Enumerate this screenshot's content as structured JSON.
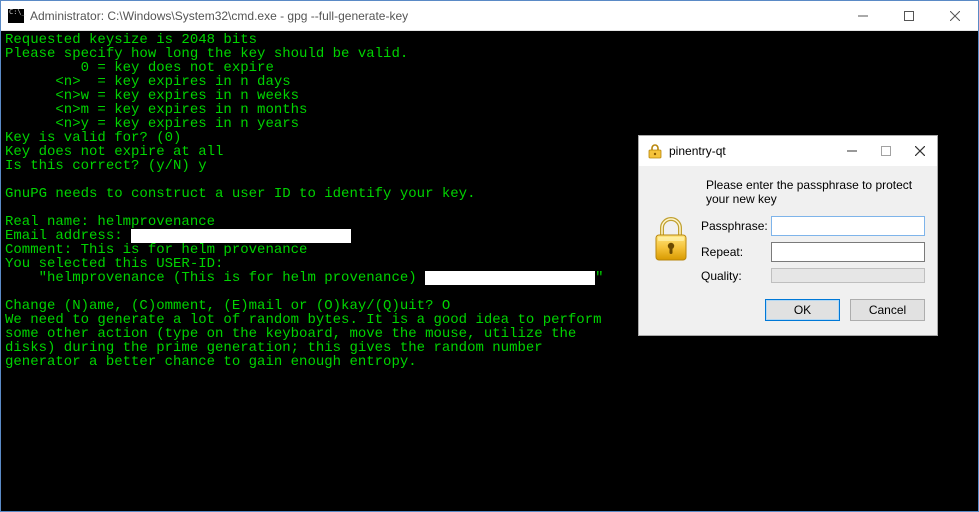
{
  "cmd": {
    "title": "Administrator: C:\\Windows\\System32\\cmd.exe - gpg  --full-generate-key",
    "lines": [
      "Requested keysize is 2048 bits",
      "Please specify how long the key should be valid.",
      "         0 = key does not expire",
      "      <n>  = key expires in n days",
      "      <n>w = key expires in n weeks",
      "      <n>m = key expires in n months",
      "      <n>y = key expires in n years",
      "Key is valid for? (0)",
      "Key does not expire at all",
      "Is this correct? (y/N) y",
      "",
      "GnuPG needs to construct a user ID to identify your key.",
      "",
      "Real name: helmprovenance"
    ],
    "email_line_prefix": "Email address: ",
    "lines2": [
      "Comment: This is for helm provenance",
      "You selected this USER-ID:"
    ],
    "userid_prefix": "    \"helmprovenance (This is for helm provenance) ",
    "userid_suffix": "\"",
    "lines3": [
      "",
      "Change (N)ame, (C)omment, (E)mail or (O)kay/(Q)uit? O",
      "We need to generate a lot of random bytes. It is a good idea to perform",
      "some other action (type on the keyboard, move the mouse, utilize the",
      "disks) during the prime generation; this gives the random number",
      "generator a better chance to gain enough entropy."
    ]
  },
  "dialog": {
    "title": "pinentry-qt",
    "instructions": "Please enter the passphrase to protect your new key",
    "labels": {
      "passphrase": "Passphrase:",
      "repeat": "Repeat:",
      "quality": "Quality:"
    },
    "passphrase_value": "",
    "repeat_value": "",
    "buttons": {
      "ok": "OK",
      "cancel": "Cancel"
    }
  }
}
